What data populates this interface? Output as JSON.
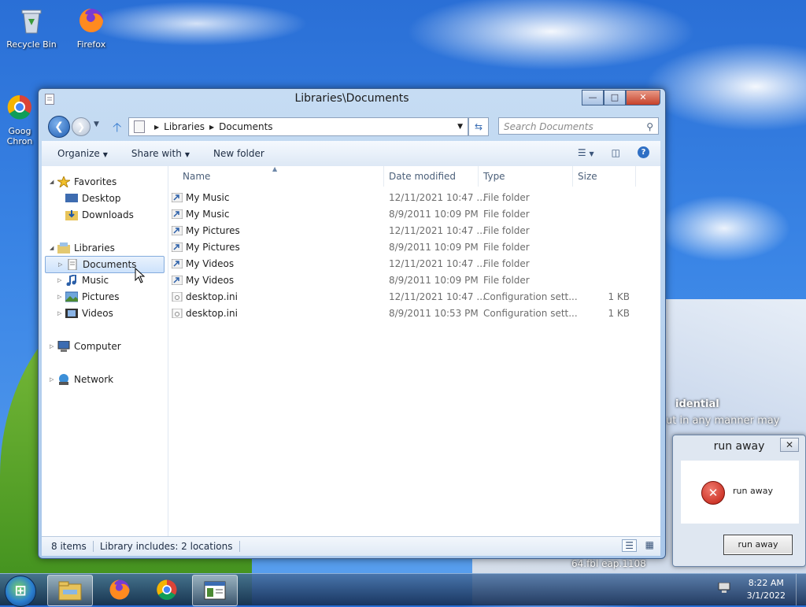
{
  "desktop": {
    "icons": [
      {
        "label": "Recycle Bin"
      },
      {
        "label": "Firefox"
      },
      {
        "label_line1": "Goog",
        "label_line2": "Chron"
      }
    ],
    "wallpaper_text": {
      "line1": "idential",
      "line2": "ut in any manner may",
      "line3": "64.fbl eap.1108"
    }
  },
  "window": {
    "title": "Libraries\\Documents",
    "buttons": {
      "minimize": "—",
      "maximize": "□",
      "close": "✕"
    },
    "address": {
      "segments": [
        "Libraries",
        "Documents"
      ]
    },
    "search": {
      "placeholder": "Search Documents"
    },
    "toolbar": {
      "organize": "Organize",
      "share_with": "Share with",
      "new_folder": "New folder",
      "help": "?"
    },
    "nav": {
      "favorites": "Favorites",
      "desktop": "Desktop",
      "downloads": "Downloads",
      "libraries": "Libraries",
      "documents": "Documents",
      "music": "Music",
      "pictures": "Pictures",
      "videos": "Videos",
      "computer": "Computer",
      "network": "Network"
    },
    "columns": {
      "name": "Name",
      "date": "Date modified",
      "type": "Type",
      "size": "Size"
    },
    "files": [
      {
        "name": "My Music",
        "date": "12/11/2021 10:47 ...",
        "type": "File folder",
        "size": ""
      },
      {
        "name": "My Music",
        "date": "8/9/2011 10:09 PM",
        "type": "File folder",
        "size": ""
      },
      {
        "name": "My Pictures",
        "date": "12/11/2021 10:47 ...",
        "type": "File folder",
        "size": ""
      },
      {
        "name": "My Pictures",
        "date": "8/9/2011 10:09 PM",
        "type": "File folder",
        "size": ""
      },
      {
        "name": "My Videos",
        "date": "12/11/2021 10:47 ...",
        "type": "File folder",
        "size": ""
      },
      {
        "name": "My Videos",
        "date": "8/9/2011 10:09 PM",
        "type": "File folder",
        "size": ""
      },
      {
        "name": "desktop.ini",
        "date": "12/11/2021 10:47 ...",
        "type": "Configuration sett...",
        "size": "1 KB"
      },
      {
        "name": "desktop.ini",
        "date": "8/9/2011 10:53 PM",
        "type": "Configuration sett...",
        "size": "1 KB"
      }
    ],
    "status": {
      "count": "8 items",
      "library": "Library includes: 2 locations"
    }
  },
  "dialog": {
    "title": "run away",
    "message": "run away",
    "button": "run away",
    "close": "✕"
  },
  "taskbar": {
    "time": "8:22 AM",
    "date": "3/1/2022"
  },
  "colors": {
    "accent": "#3b86e6",
    "selection": "#cde2fb",
    "error": "#c01d10"
  }
}
